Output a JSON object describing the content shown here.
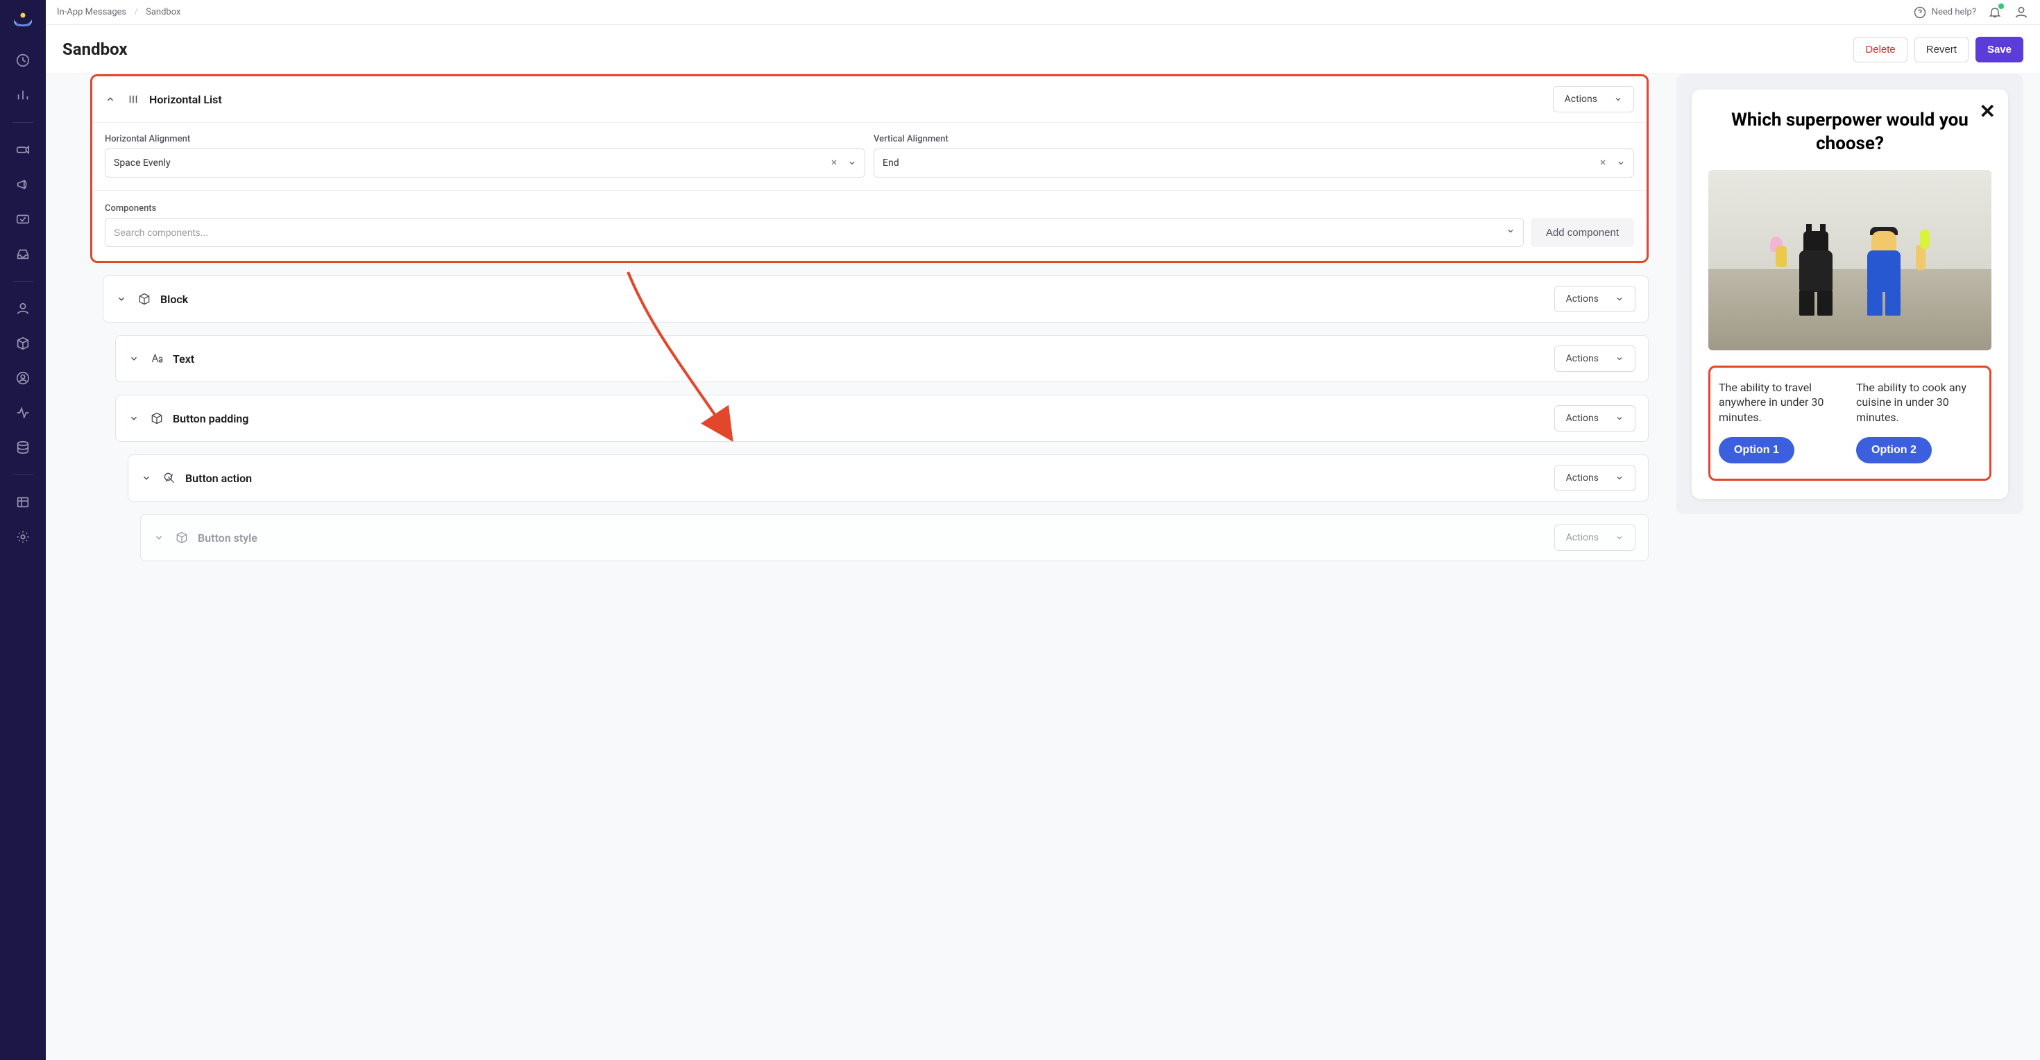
{
  "breadcrumb": {
    "parent": "In-App Messages",
    "current": "Sandbox"
  },
  "top": {
    "help_label": "Need help?"
  },
  "header": {
    "title": "Sandbox",
    "delete": "Delete",
    "revert": "Revert",
    "save": "Save"
  },
  "editor": {
    "card0": {
      "name": "Horizontal List",
      "actions_label": "Actions",
      "halign_label": "Horizontal Alignment",
      "halign_value": "Space Evenly",
      "valign_label": "Vertical Alignment",
      "valign_value": "End",
      "components_label": "Components",
      "search_placeholder": "Search components...",
      "add_label": "Add component"
    },
    "card1": {
      "name": "Block",
      "actions_label": "Actions"
    },
    "card2": {
      "name": "Text",
      "actions_label": "Actions"
    },
    "card3": {
      "name": "Button padding",
      "actions_label": "Actions"
    },
    "card4": {
      "name": "Button action",
      "actions_label": "Actions"
    },
    "card5": {
      "name": "Button style",
      "actions_label": "Actions"
    }
  },
  "preview": {
    "question": "Which superpower would you choose?",
    "opt1_text": "The ability to travel anywhere in under 30 minutes.",
    "opt1_btn": "Option 1",
    "opt2_text": "The ability to cook any cuisine in under 30 minutes.",
    "opt2_btn": "Option 2"
  }
}
